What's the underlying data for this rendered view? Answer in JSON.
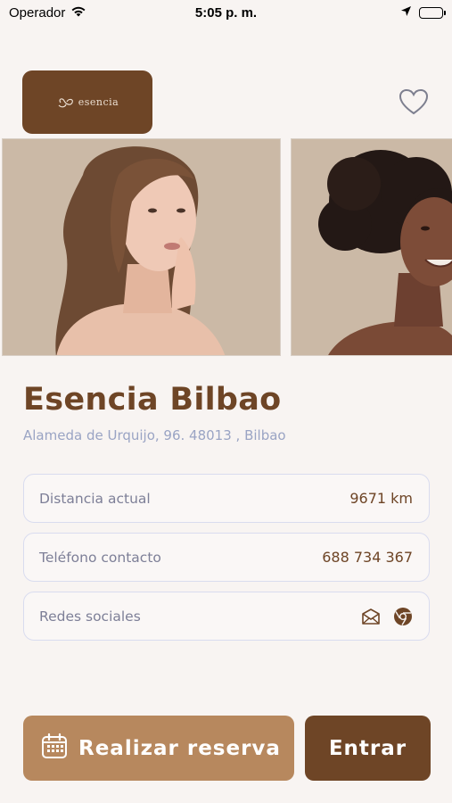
{
  "status_bar": {
    "carrier": "Operador",
    "time": "5:05 p. m.",
    "icons": [
      "wifi-icon",
      "location-arrow-icon",
      "battery-icon"
    ]
  },
  "header": {
    "logo_text": "esencia",
    "favorite_icon": "heart-outline-icon"
  },
  "gallery": {
    "photos": [
      "woman-with-long-brown-hair",
      "woman-with-curly-hair"
    ]
  },
  "salon": {
    "name": "Esencia Bilbao",
    "address": "Alameda de Urquijo, 96. 48013 , Bilbao"
  },
  "info": {
    "distance_label": "Distancia actual",
    "distance_value": "9671 km",
    "phone_label": "Teléfono contacto",
    "phone_value": "688 734 367",
    "social_label": "Redes sociales",
    "social_icons": [
      "mail-icon",
      "chrome-icon"
    ]
  },
  "actions": {
    "reserve_label": "Realizar reserva",
    "reserve_icon": "calendar-icon",
    "enter_label": "Entrar"
  },
  "colors": {
    "brand_brown": "#6e4526",
    "light_brown": "#b7885e",
    "background": "#f8f4f2",
    "address_blue": "#9aa4c4"
  }
}
